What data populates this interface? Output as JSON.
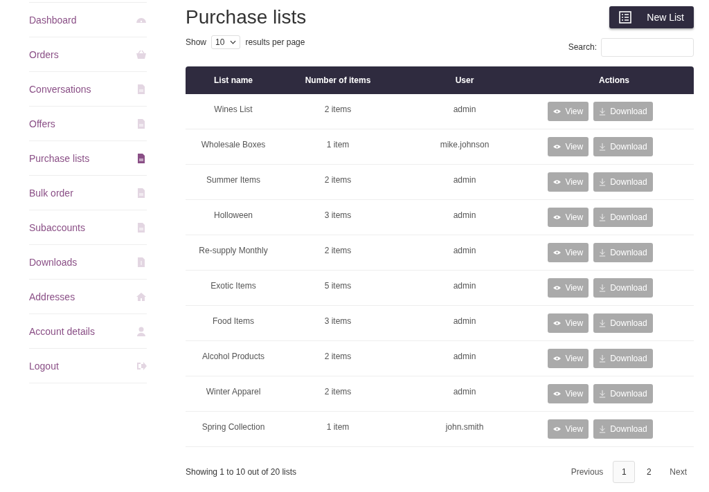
{
  "sidebar": {
    "items": [
      {
        "label": "Dashboard",
        "kind": "gauge",
        "selected": false
      },
      {
        "label": "Orders",
        "kind": "basket",
        "selected": false
      },
      {
        "label": "Conversations",
        "kind": "doc",
        "selected": false
      },
      {
        "label": "Offers",
        "kind": "doc",
        "selected": false
      },
      {
        "label": "Purchase lists",
        "kind": "doc",
        "selected": true
      },
      {
        "label": "Bulk order",
        "kind": "doc",
        "selected": false
      },
      {
        "label": "Subaccounts",
        "kind": "doc",
        "selected": false
      },
      {
        "label": "Downloads",
        "kind": "download",
        "selected": false
      },
      {
        "label": "Addresses",
        "kind": "home",
        "selected": false
      },
      {
        "label": "Account details",
        "kind": "user",
        "selected": false
      },
      {
        "label": "Logout",
        "kind": "logout",
        "selected": false
      }
    ]
  },
  "page": {
    "title": "Purchase lists",
    "new_button": "New List"
  },
  "length": {
    "show": "Show",
    "value": "10",
    "suffix": "results per page"
  },
  "search": {
    "label": "Search:"
  },
  "table": {
    "columns": [
      "List name",
      "Number of items",
      "User",
      "Actions"
    ],
    "rows": [
      {
        "name": "Wines List",
        "items": "2 items",
        "user": "admin",
        "view": "View",
        "download": "Download"
      },
      {
        "name": "Wholesale Boxes",
        "items": "1 item",
        "user": "mike.johnson",
        "view": "View",
        "download": "Download"
      },
      {
        "name": "Summer Items",
        "items": "2 items",
        "user": "admin",
        "view": "View",
        "download": "Download"
      },
      {
        "name": "Holloween",
        "items": "3 items",
        "user": "admin",
        "view": "View",
        "download": "Download"
      },
      {
        "name": "Re-supply Monthly",
        "items": "2 items",
        "user": "admin",
        "view": "View",
        "download": "Download"
      },
      {
        "name": "Exotic Items",
        "items": "5 items",
        "user": "admin",
        "view": "View",
        "download": "Download"
      },
      {
        "name": "Food Items",
        "items": "3 items",
        "user": "admin",
        "view": "View",
        "download": "Download"
      },
      {
        "name": "Alcohol Products",
        "items": "2 items",
        "user": "admin",
        "view": "View",
        "download": "Download"
      },
      {
        "name": "Winter Apparel",
        "items": "2 items",
        "user": "admin",
        "view": "View",
        "download": "Download"
      },
      {
        "name": "Spring Collection",
        "items": "1 item",
        "user": "john.smith",
        "view": "View",
        "download": "Download"
      }
    ]
  },
  "footer": {
    "info": "Showing 1 to 10 out of 20 lists",
    "previous": "Previous",
    "next": "Next",
    "pages": [
      {
        "label": "1",
        "selected": true
      },
      {
        "label": "2",
        "selected": false
      }
    ]
  }
}
